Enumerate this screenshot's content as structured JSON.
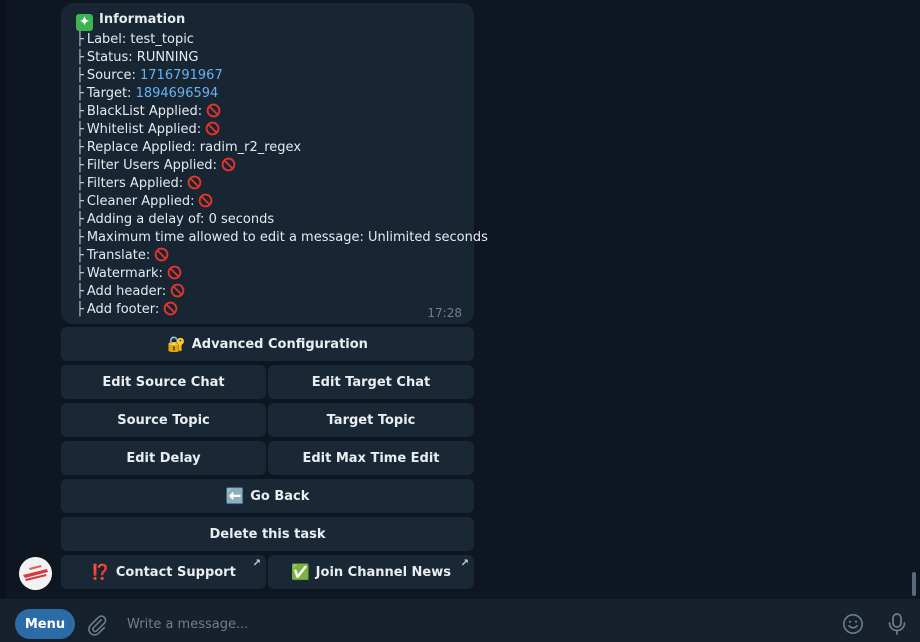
{
  "message": {
    "title": "Information",
    "timestamp": "17:28",
    "lines": [
      {
        "label": "Label:",
        "value": "test_topic"
      },
      {
        "label": "Status:",
        "value": "RUNNING"
      },
      {
        "label": "Source:",
        "link": "1716791967"
      },
      {
        "label": "Target:",
        "link": "1894696594"
      },
      {
        "label": "BlackList Applied:",
        "icon": "prohibited-icon"
      },
      {
        "label": "Whitelist Applied:",
        "icon": "prohibited-icon"
      },
      {
        "label": "Replace Applied:",
        "value": "radim_r2_regex"
      },
      {
        "label": "Filter Users Applied:",
        "icon": "prohibited-icon"
      },
      {
        "label": "Filters Applied:",
        "icon": "prohibited-icon"
      },
      {
        "label": "Cleaner Applied:",
        "icon": "prohibited-icon"
      },
      {
        "label": "Adding a delay of:",
        "value": "0 seconds"
      },
      {
        "label": "Maximum time allowed to edit a message:",
        "value": "Unlimited seconds"
      },
      {
        "label": "Translate:",
        "icon": "prohibited-icon"
      },
      {
        "label": "Watermark:",
        "icon": "prohibited-icon"
      },
      {
        "label": "Add header:",
        "icon": "prohibited-icon"
      },
      {
        "label": "Add footer:",
        "icon": "prohibited-icon"
      }
    ]
  },
  "keyboard": {
    "advanced": "Advanced Configuration",
    "edit_source": "Edit Source Chat",
    "edit_target": "Edit Target Chat",
    "source_topic": "Source Topic",
    "target_topic": "Target Topic",
    "edit_delay": "Edit Delay",
    "edit_max_time": "Edit Max Time Edit",
    "go_back": "Go Back",
    "delete_task": "Delete this task",
    "contact_support": "Contact Support",
    "join_channel": "Join Channel News"
  },
  "composer": {
    "menu_label": "Menu",
    "placeholder": "Write a message..."
  },
  "colors": {
    "background": "#0e1621",
    "bubble": "#182533",
    "link": "#6ab2f2",
    "menu_button": "#2b6ca6"
  }
}
